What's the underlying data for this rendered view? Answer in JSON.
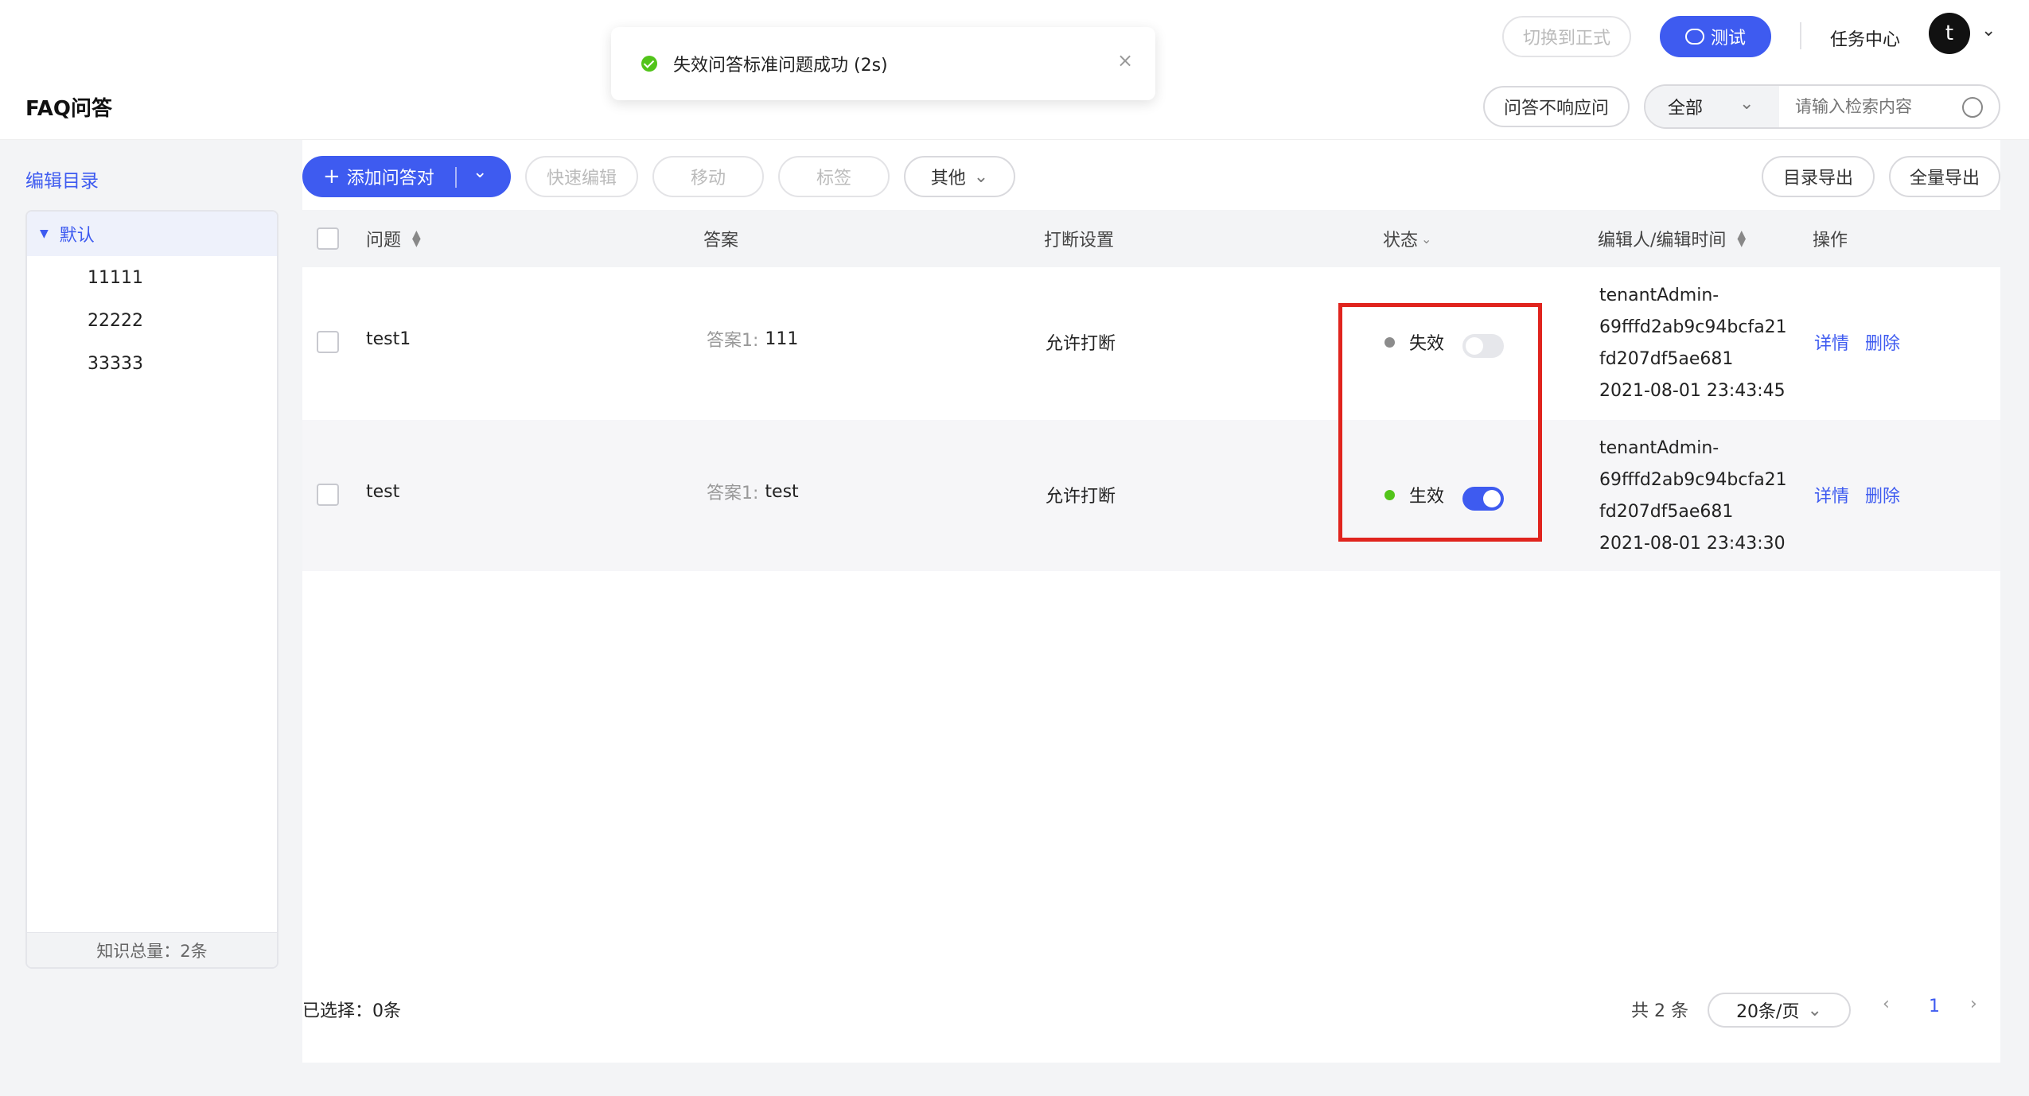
{
  "topbar": {
    "switch_formal": "切换到正式",
    "test_button": "测试",
    "task_center": "任务中心",
    "avatar_letter": "t"
  },
  "toast": {
    "message": "失效问答标准问题成功 (2s)"
  },
  "header": {
    "title": "FAQ问答",
    "unresponsive_button": "问答不响应问",
    "filter_selected": "全部",
    "search_placeholder": "请输入检索内容"
  },
  "sidebar": {
    "edit_catalog": "编辑目录",
    "root": "默认",
    "children": [
      "11111",
      "22222",
      "33333"
    ],
    "footer": "知识总量：2条"
  },
  "toolbar": {
    "add_pair": "添加问答对",
    "quick_edit": "快速编辑",
    "move": "移动",
    "tag": "标签",
    "other": "其他",
    "export_catalog": "目录导出",
    "export_all": "全量导出"
  },
  "table": {
    "headers": {
      "question": "问题",
      "answer": "答案",
      "interrupt": "打断设置",
      "status": "状态",
      "editor": "编辑人/编辑时间",
      "action": "操作"
    },
    "rows": [
      {
        "question": "test1",
        "answer_label": "答案1:",
        "answer": "111",
        "interrupt": "允许打断",
        "status": "失效",
        "status_color": "#8c8c8c",
        "enabled": false,
        "editor_1": "tenantAdmin-",
        "editor_2": "69fffd2ab9c94bcfa21",
        "editor_3": "fd207df5ae681",
        "time": "2021-08-01 23:43:45",
        "detail": "详情",
        "delete": "删除"
      },
      {
        "question": "test",
        "answer_label": "答案1:",
        "answer": "test",
        "interrupt": "允许打断",
        "status": "生效",
        "status_color": "#52c41a",
        "enabled": true,
        "editor_1": "tenantAdmin-",
        "editor_2": "69fffd2ab9c94bcfa21",
        "editor_3": "fd207df5ae681",
        "time": "2021-08-01 23:43:30",
        "detail": "详情",
        "delete": "删除"
      }
    ]
  },
  "footer": {
    "selected": "已选择：0条",
    "total": "共 2 条",
    "page_size": "20条/页",
    "current_page": "1"
  },
  "colors": {
    "primary": "#3e5bf0",
    "highlight": "#e0241e"
  }
}
